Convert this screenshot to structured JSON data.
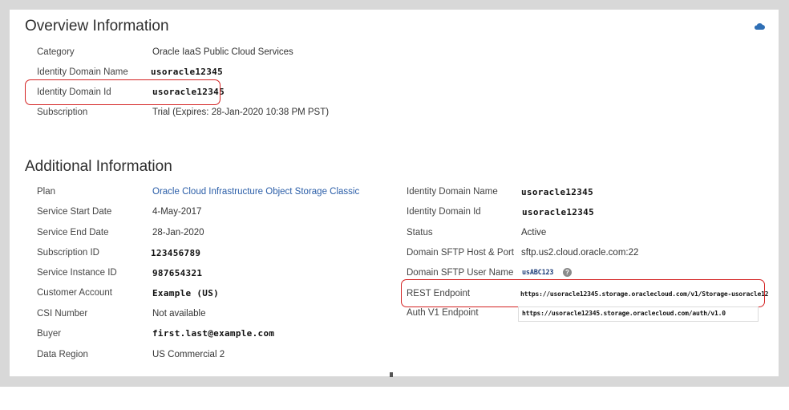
{
  "overview": {
    "title": "Overview Information",
    "rows": [
      {
        "label": "Category",
        "value": "Oracle IaaS Public Cloud Services"
      },
      {
        "label": "Identity Domain Name",
        "value": "usoracle12345"
      },
      {
        "label": "Identity Domain Id",
        "value": "usoracle12345"
      },
      {
        "label": "Subscription",
        "value": "Trial (Expires: 28-Jan-2020 10:38 PM PST)"
      }
    ]
  },
  "additional": {
    "title": "Additional Information",
    "left": [
      {
        "label": "Plan",
        "value": "Oracle Cloud Infrastructure Object Storage Classic"
      },
      {
        "label": "Service Start Date",
        "value": "4-May-2017"
      },
      {
        "label": "Service End Date",
        "value": "28-Jan-2020"
      },
      {
        "label": "Subscription ID",
        "value": "123456789"
      },
      {
        "label": "Service Instance ID",
        "value": "987654321"
      },
      {
        "label": "Customer Account",
        "value": "Example (US)"
      },
      {
        "label": "CSI Number",
        "value": "Not available"
      },
      {
        "label": "Buyer",
        "value": "first.last@example.com"
      },
      {
        "label": "Data Region",
        "value": "US Commercial 2"
      }
    ],
    "right": [
      {
        "label": "Identity Domain Name",
        "value": "usoracle12345"
      },
      {
        "label": "Identity Domain Id",
        "value": "usoracle12345"
      },
      {
        "label": "Status",
        "value": "Active"
      },
      {
        "label": "Domain SFTP Host & Port",
        "value": "sftp.us2.cloud.oracle.com:22"
      },
      {
        "label": "Domain SFTP User Name",
        "value": "usABC123"
      },
      {
        "label": "REST Endpoint",
        "value": "https://usoracle12345.storage.oraclecloud.com/v1/Storage-usoracle12"
      },
      {
        "label": "Auth V1 Endpoint",
        "value": "https://usoracle12345.storage.oraclecloud.com/auth/v1.0"
      }
    ],
    "help_glyph": "?"
  },
  "colors": {
    "highlight": "#d42323",
    "link": "#2b5ea8",
    "cloud_icon": "#2f6fb5"
  }
}
